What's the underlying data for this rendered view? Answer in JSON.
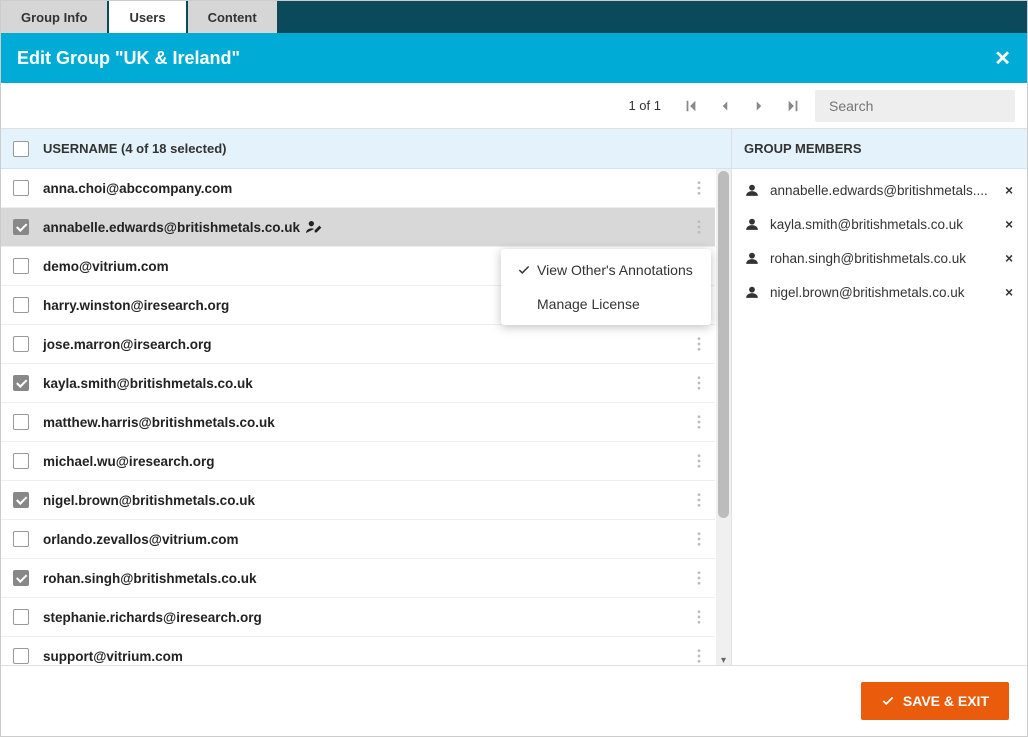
{
  "tabs": [
    {
      "label": "Group Info",
      "active": false
    },
    {
      "label": "Users",
      "active": true
    },
    {
      "label": "Content",
      "active": false
    }
  ],
  "title": "Edit Group \"UK & Ireland\"",
  "pager": {
    "text": "1 of 1"
  },
  "search": {
    "placeholder": "Search"
  },
  "username_header": "USERNAME (4 of 18 selected)",
  "members_header": "GROUP MEMBERS",
  "users": [
    {
      "name": "anna.choi@abccompany.com",
      "checked": false,
      "active": false,
      "editIcon": false
    },
    {
      "name": "annabelle.edwards@britishmetals.co.uk",
      "checked": true,
      "active": true,
      "editIcon": true
    },
    {
      "name": "demo@vitrium.com",
      "checked": false,
      "active": false,
      "editIcon": false
    },
    {
      "name": "harry.winston@iresearch.org",
      "checked": false,
      "active": false,
      "editIcon": false
    },
    {
      "name": "jose.marron@irsearch.org",
      "checked": false,
      "active": false,
      "editIcon": false
    },
    {
      "name": "kayla.smith@britishmetals.co.uk",
      "checked": true,
      "active": false,
      "editIcon": false
    },
    {
      "name": "matthew.harris@britishmetals.co.uk",
      "checked": false,
      "active": false,
      "editIcon": false
    },
    {
      "name": "michael.wu@iresearch.org",
      "checked": false,
      "active": false,
      "editIcon": false
    },
    {
      "name": "nigel.brown@britishmetals.co.uk",
      "checked": true,
      "active": false,
      "editIcon": false
    },
    {
      "name": "orlando.zevallos@vitrium.com",
      "checked": false,
      "active": false,
      "editIcon": false
    },
    {
      "name": "rohan.singh@britishmetals.co.uk",
      "checked": true,
      "active": false,
      "editIcon": false
    },
    {
      "name": "stephanie.richards@iresearch.org",
      "checked": false,
      "active": false,
      "editIcon": false
    },
    {
      "name": "support@vitrium.com",
      "checked": false,
      "active": false,
      "editIcon": false
    }
  ],
  "members": [
    {
      "name": "annabelle.edwards@britishmetals...."
    },
    {
      "name": "kayla.smith@britishmetals.co.uk"
    },
    {
      "name": "rohan.singh@britishmetals.co.uk"
    },
    {
      "name": "nigel.brown@britishmetals.co.uk"
    }
  ],
  "context_menu": [
    {
      "label": "View Other's Annotations",
      "checked": true
    },
    {
      "label": "Manage License",
      "checked": false
    }
  ],
  "save_label": "SAVE & EXIT"
}
